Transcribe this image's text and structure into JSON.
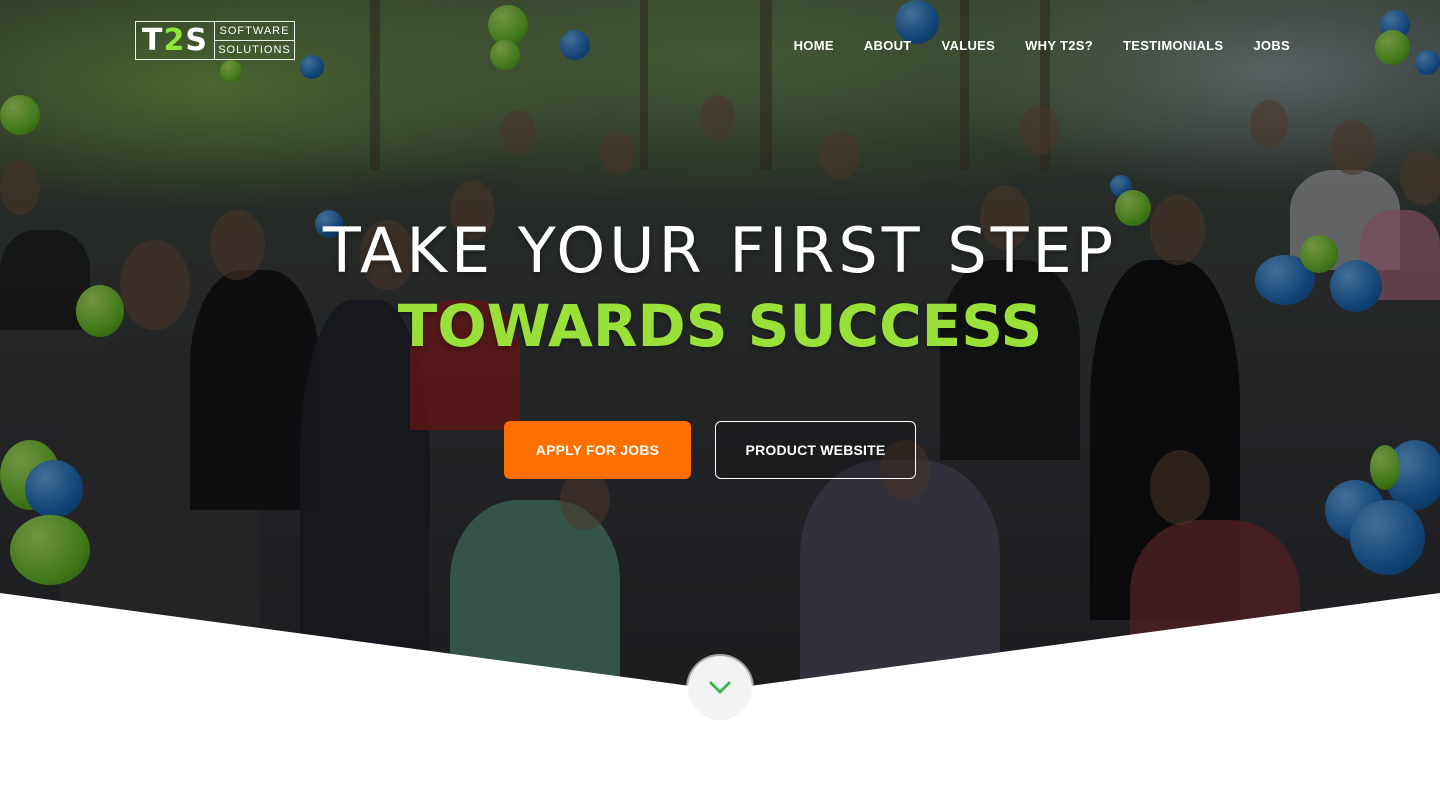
{
  "header": {
    "logo": {
      "mark_letters": [
        "T",
        "2",
        "S"
      ],
      "line1": "SOFTWARE",
      "line2": "SOLUTIONS"
    },
    "nav": [
      {
        "label": "HOME"
      },
      {
        "label": "ABOUT"
      },
      {
        "label": "VALUES"
      },
      {
        "label": "WHY T2S?"
      },
      {
        "label": "TESTIMONIALS"
      },
      {
        "label": "JOBS"
      }
    ]
  },
  "hero": {
    "headline": "TAKE YOUR FIRST STEP",
    "subheadline": "TOWARDS SUCCESS",
    "primary_button": "APPLY FOR JOBS",
    "secondary_button": "PRODUCT WEBSITE",
    "scroll_icon": "chevron-down-icon"
  },
  "colors": {
    "accent_green": "#99e038",
    "primary_orange": "#ff6f00",
    "chevron_green": "#3cb54a"
  }
}
